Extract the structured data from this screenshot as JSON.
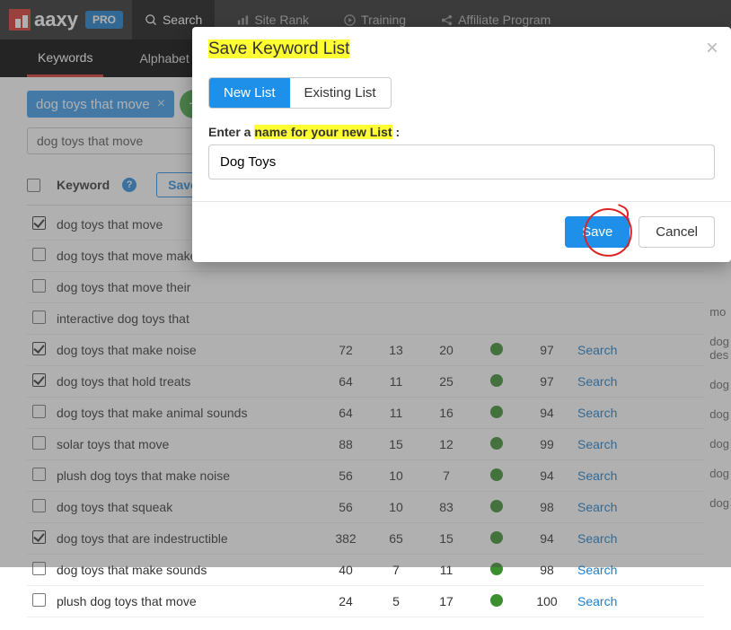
{
  "brand": {
    "name": "aaxy",
    "plan": "PRO"
  },
  "topnav": {
    "search": "Search",
    "siterank": "Site Rank",
    "training": "Training",
    "affiliate": "Affiliate Program"
  },
  "subnav": {
    "keywords": "Keywords",
    "alphabet": "Alphabet Sou"
  },
  "search": {
    "chip": "dog toys that move",
    "input_value": "dog toys that move"
  },
  "table": {
    "header_keyword": "Keyword",
    "save_to": "Save to",
    "search_link": "Search",
    "rows": [
      {
        "checked": true,
        "kw": "dog toys that move"
      },
      {
        "checked": false,
        "kw": "dog toys that move make"
      },
      {
        "checked": false,
        "kw": "dog toys that move their"
      },
      {
        "checked": false,
        "kw": "interactive dog toys that"
      },
      {
        "checked": true,
        "kw": "dog toys that make noise",
        "c1": 72,
        "c2": 13,
        "c3": 20,
        "score": 97
      },
      {
        "checked": true,
        "kw": "dog toys that hold treats",
        "c1": 64,
        "c2": 11,
        "c3": 25,
        "score": 97
      },
      {
        "checked": false,
        "kw": "dog toys that make animal sounds",
        "c1": 64,
        "c2": 11,
        "c3": 16,
        "score": 94
      },
      {
        "checked": false,
        "kw": "solar toys that move",
        "c1": 88,
        "c2": 15,
        "c3": 12,
        "score": 99
      },
      {
        "checked": false,
        "kw": "plush dog toys that make noise",
        "c1": 56,
        "c2": 10,
        "c3": 7,
        "score": 94
      },
      {
        "checked": false,
        "kw": "dog toys that squeak",
        "c1": 56,
        "c2": 10,
        "c3": 83,
        "score": 98
      },
      {
        "checked": true,
        "kw": "dog toys that are indestructible",
        "c1": 382,
        "c2": 65,
        "c3": 15,
        "score": 94
      },
      {
        "checked": false,
        "kw": "dog toys that make sounds",
        "c1": 40,
        "c2": 7,
        "c3": 11,
        "score": 98
      },
      {
        "checked": false,
        "kw": "plush dog toys that move",
        "c1": 24,
        "c2": 5,
        "c3": 17,
        "score": 100
      }
    ]
  },
  "side_snips": [
    "mo",
    "dog\ndes",
    "dog",
    "dog",
    "dog",
    "dog",
    "dog"
  ],
  "modal": {
    "title": "Save Keyword List ",
    "tab_new": "New List",
    "tab_existing": "Existing List",
    "label_pre": "Enter a ",
    "label_hl": "name for your new List",
    "label_post": " :",
    "value": "Dog Toys",
    "save": "Save",
    "cancel": "Cancel"
  }
}
